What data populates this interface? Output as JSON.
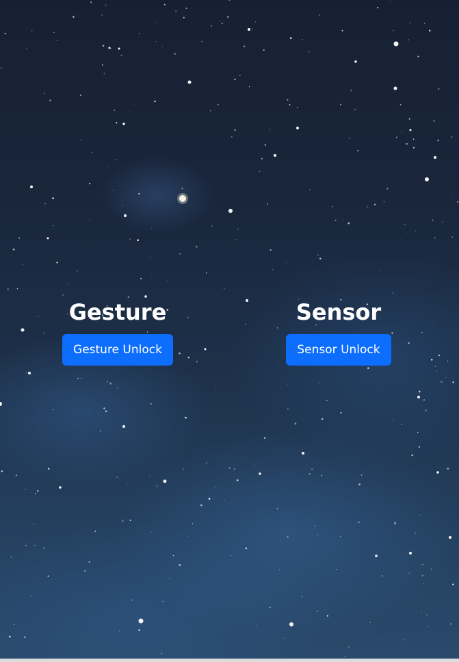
{
  "gesture": {
    "heading": "Gesture",
    "button_label": "Gesture Unlock"
  },
  "sensor": {
    "heading": "Sensor",
    "button_label": "Sensor Unlock"
  },
  "colors": {
    "button_bg": "#0d6efd",
    "heading_text": "#ffffff",
    "sky_top": "#172033",
    "sky_bottom": "#2a4a6c"
  }
}
